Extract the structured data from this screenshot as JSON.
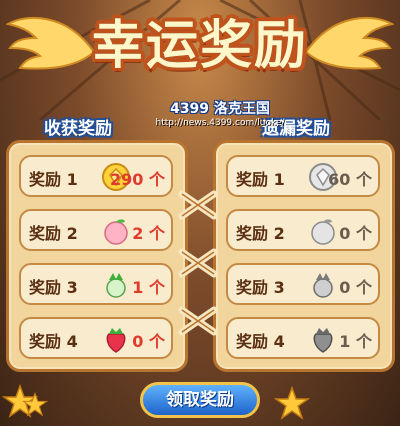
{
  "banner": {
    "title": "幸运奖励"
  },
  "watermark": {
    "brand": "4399 洛克王国",
    "url": "http://news.4399.com/luoke/"
  },
  "sections": {
    "collected_title": "收获奖励",
    "missed_title": "遗漏奖励"
  },
  "collected": [
    {
      "label": "奖励 1",
      "icon": "gold-coin-icon",
      "value": "290 个"
    },
    {
      "label": "奖励 2",
      "icon": "peach-icon",
      "value": "2 个"
    },
    {
      "label": "奖励 3",
      "icon": "green-vegetable-icon",
      "value": "1 个"
    },
    {
      "label": "奖励 4",
      "icon": "strawberry-icon",
      "value": "0 个"
    }
  ],
  "missed": [
    {
      "label": "奖励 1",
      "icon": "silver-coin-icon",
      "value": "60 个"
    },
    {
      "label": "奖励 2",
      "icon": "gray-peach-icon",
      "value": "0 个"
    },
    {
      "label": "奖励 3",
      "icon": "gray-vegetable-icon",
      "value": "0 个"
    },
    {
      "label": "奖励 4",
      "icon": "gray-strawberry-icon",
      "value": "1 个"
    }
  ],
  "claim_button": {
    "label": "领取奖励"
  },
  "colors": {
    "value_red": "#e03a2a",
    "value_gray": "#6c5c50",
    "button_blue": "#1d63c8",
    "panel_tan": "#f2d59c"
  }
}
